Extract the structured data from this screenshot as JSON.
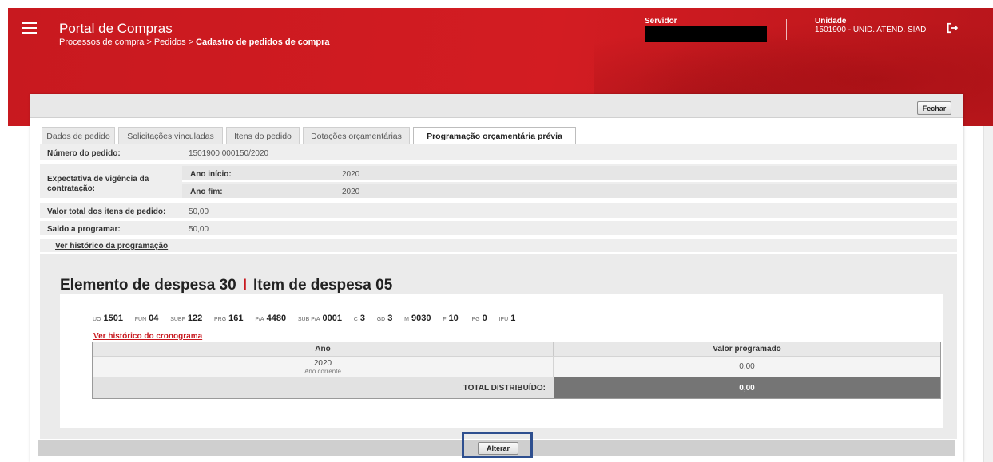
{
  "header": {
    "app_title": "Portal de Compras",
    "breadcrumb": [
      "Processos de compra",
      "Pedidos",
      "Cadastro de pedidos de compra"
    ],
    "breadcrumb_sep": ">",
    "servidor_label": "Servidor",
    "unidade_label": "Unidade",
    "unidade_value": "1501900 - UNID. ATEND. SIAD",
    "menu_icon": "hamburger-menu-icon",
    "logout_icon": "logout-icon",
    "brand_color": "#c8191f"
  },
  "toolbar": {
    "close_label": "Fechar"
  },
  "tabs": [
    {
      "label": "Dados de pedido",
      "active": false
    },
    {
      "label": "Solicitações vinculadas",
      "active": false
    },
    {
      "label": "Itens do pedido",
      "active": false
    },
    {
      "label": "Dotações orçamentárias",
      "active": false
    },
    {
      "label": "Programação orçamentária prévia",
      "active": true
    }
  ],
  "form": {
    "numero_label": "Número do pedido:",
    "numero_value": "1501900 000150/2020",
    "vigencia_label": "Expectativa de vigência da contratação:",
    "ano_inicio_label": "Ano início:",
    "ano_inicio_value": "2020",
    "ano_fim_label": "Ano fim:",
    "ano_fim_value": "2020",
    "valor_total_label": "Valor total dos itens de pedido:",
    "valor_total_value": "50,00",
    "saldo_label": "Saldo a programar:",
    "saldo_value": "50,00",
    "historico_link": "Ver histórico da programação"
  },
  "section": {
    "elemento_label": "Elemento de despesa 30",
    "separator": "I",
    "item_label": "Item de despesa 05",
    "codes": [
      {
        "key": "UO",
        "value": "1501"
      },
      {
        "key": "FUN",
        "value": "04"
      },
      {
        "key": "SUBF",
        "value": "122"
      },
      {
        "key": "PRG",
        "value": "161"
      },
      {
        "key": "P/A",
        "value": "4480"
      },
      {
        "key": "SUB P/A",
        "value": "0001"
      },
      {
        "key": "C",
        "value": "3"
      },
      {
        "key": "GD",
        "value": "3"
      },
      {
        "key": "M",
        "value": "9030"
      },
      {
        "key": "F",
        "value": "10"
      },
      {
        "key": "IPG",
        "value": "0"
      },
      {
        "key": "IPU",
        "value": "1"
      }
    ],
    "cronograma_link": "Ver histórico do cronograma",
    "table": {
      "headers": [
        "Ano",
        "Valor programado"
      ],
      "rows": [
        {
          "ano": "2020",
          "sub": "Ano corrente",
          "valor": "0,00"
        }
      ],
      "total_label": "TOTAL DISTRIBUÍDO:",
      "total_value": "0,00"
    }
  },
  "footer": {
    "alterar_label": "Alterar"
  }
}
